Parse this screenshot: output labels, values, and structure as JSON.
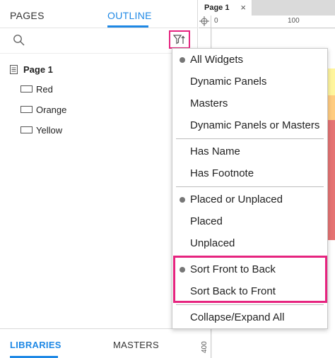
{
  "left_panel": {
    "tabs": {
      "pages": "PAGES",
      "outline": "OUTLINE"
    },
    "tree": {
      "page": "Page 1",
      "widgets": [
        "Red",
        "Orange",
        "Yellow"
      ]
    },
    "bottom_tabs": {
      "libraries": "LIBRARIES",
      "masters": "MASTERS"
    }
  },
  "canvas": {
    "page_tab": "Page 1",
    "close_glyph": "×",
    "ruler_h_labels": [
      "0",
      "100"
    ],
    "ruler_v_label": "400"
  },
  "filter_menu": {
    "items": [
      {
        "label": "All Widgets",
        "selected": true
      },
      {
        "label": "Dynamic Panels",
        "selected": false
      },
      {
        "label": "Masters",
        "selected": false
      },
      {
        "label": "Dynamic Panels or Masters",
        "selected": false
      },
      {
        "label": "Has Name",
        "selected": false
      },
      {
        "label": "Has Footnote",
        "selected": false
      },
      {
        "label": "Placed or Unplaced",
        "selected": true
      },
      {
        "label": "Placed",
        "selected": false
      },
      {
        "label": "Unplaced",
        "selected": false
      },
      {
        "label": "Sort Front to Back",
        "selected": true
      },
      {
        "label": "Sort Back to Front",
        "selected": false
      },
      {
        "label": "Collapse/Expand All",
        "selected": false
      }
    ]
  },
  "colors": {
    "accent": "#1e88e5",
    "highlight": "#e6247f",
    "strip_yellow": "#fff59d",
    "strip_orange": "#ffcc80",
    "strip_red": "#e57373"
  }
}
